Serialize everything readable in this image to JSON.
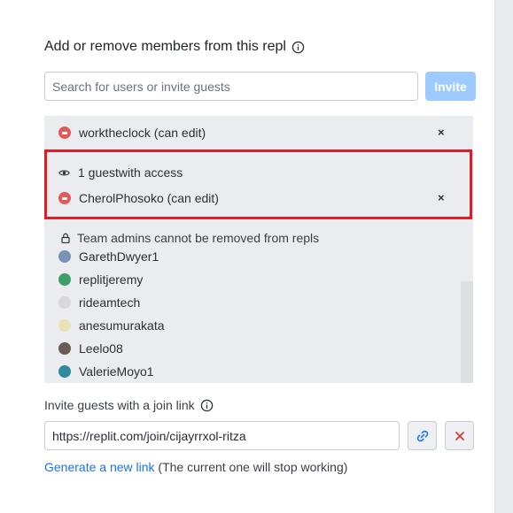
{
  "dialog": {
    "title": "Add or remove members from this repl"
  },
  "search": {
    "placeholder": "Search for users or invite guests",
    "invite_label": "Invite"
  },
  "members": {
    "top": [
      {
        "label": "worktheclock (can edit)",
        "remove": "×"
      }
    ],
    "guests_header": "1 guestwith access",
    "guests": [
      {
        "label": "CherolPhosoko (can edit)",
        "remove": "×"
      }
    ],
    "admins_note": "Team admins cannot be removed from repls",
    "team": [
      {
        "name": "GarethDwyer1",
        "color": "#7a93b4"
      },
      {
        "name": "replitjeremy",
        "color": "#3f9d6a"
      },
      {
        "name": "rideamtech",
        "color": "#d8d8d8"
      },
      {
        "name": "anesumurakata",
        "color": "#e7e2b8"
      },
      {
        "name": "Leelo08",
        "color": "#6b5a52"
      },
      {
        "name": "ValerieMoyo1",
        "color": "#2f8a9b"
      }
    ]
  },
  "join_link": {
    "label": "Invite guests with a join link",
    "url": "https://replit.com/join/cijayrrxol-ritza",
    "generate_link_text": "Generate a new link",
    "generate_note": "(The current one will stop working)"
  },
  "colors": {
    "accent": "#1a73e8",
    "highlight_border": "#e01c24",
    "invite_button": "#9ecbff",
    "danger": "#d93838"
  }
}
